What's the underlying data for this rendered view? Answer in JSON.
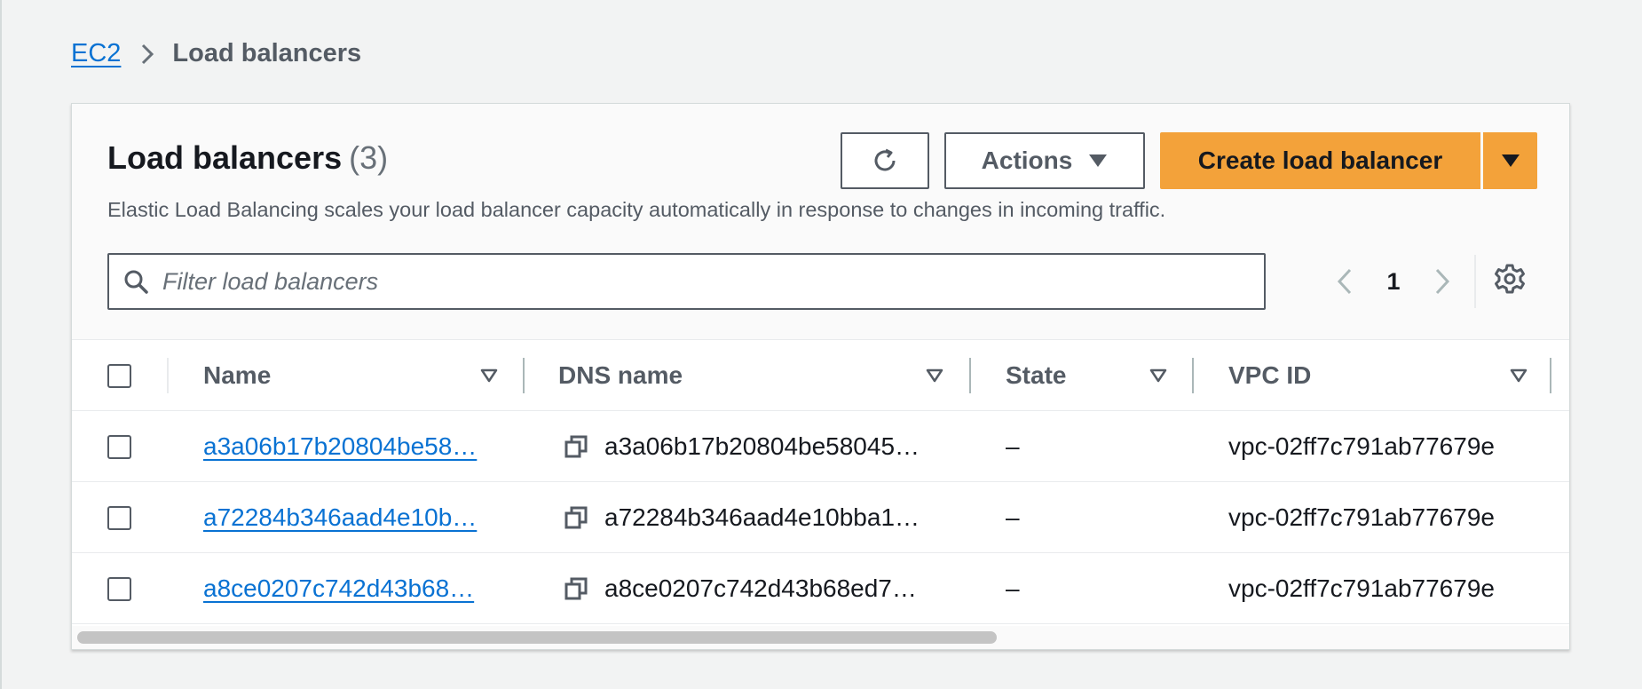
{
  "breadcrumb": {
    "root": "EC2",
    "current": "Load balancers"
  },
  "panel": {
    "title": "Load balancers",
    "count": "(3)",
    "description": "Elastic Load Balancing scales your load balancer capacity automatically in response to changes in incoming traffic."
  },
  "toolbar": {
    "refresh_icon": "refresh-icon",
    "actions_label": "Actions",
    "create_label": "Create load balancer"
  },
  "filter": {
    "placeholder": "Filter load balancers",
    "value": ""
  },
  "pagination": {
    "current_page": "1"
  },
  "table": {
    "columns": [
      "Name",
      "DNS name",
      "State",
      "VPC ID"
    ],
    "rows": [
      {
        "name": "a3a06b17b20804be58…",
        "dns": "a3a06b17b20804be58045…",
        "state": "–",
        "vpc": "vpc-02ff7c791ab77679e"
      },
      {
        "name": "a72284b346aad4e10b…",
        "dns": "a72284b346aad4e10bba1…",
        "state": "–",
        "vpc": "vpc-02ff7c791ab77679e"
      },
      {
        "name": "a8ce0207c742d43b68…",
        "dns": "a8ce0207c742d43b68ed7…",
        "state": "–",
        "vpc": "vpc-02ff7c791ab77679e"
      }
    ]
  },
  "colors": {
    "page_bg": "#f2f3f3",
    "primary_button": "#f3a23a",
    "link": "#0972d3",
    "text": "#16191f",
    "muted_text": "#545b64"
  }
}
